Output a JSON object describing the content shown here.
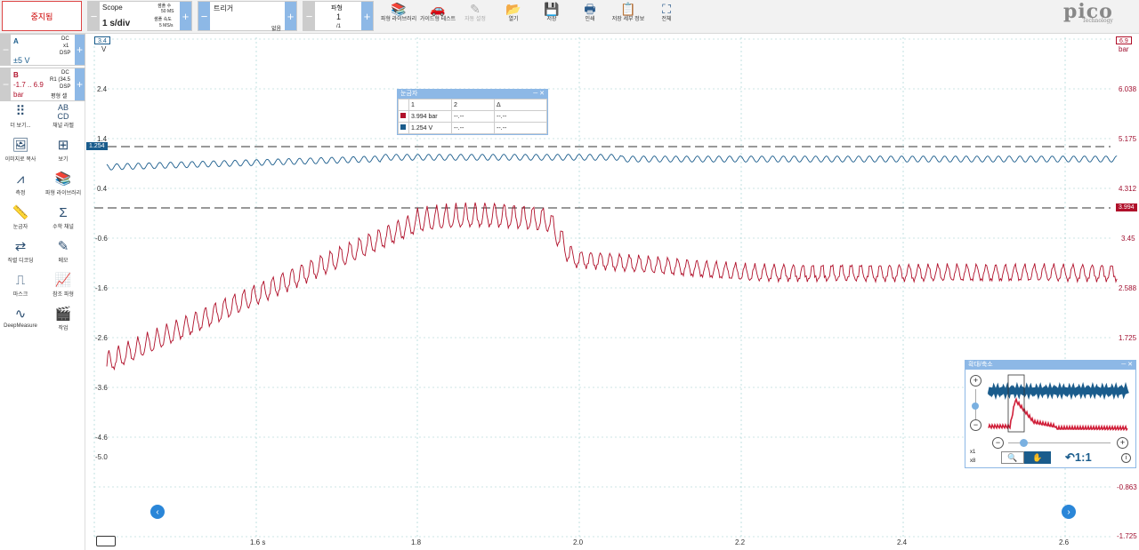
{
  "toolbar": {
    "stop_label": "중지됨",
    "scope_title": "Scope",
    "timebase": "1 s/div",
    "samples_label": "샘플 수",
    "samples": "50 MS",
    "rate_label": "샘플 속도",
    "rate": "5 MS/s",
    "trigger_title": "트리거",
    "trigger_mode": "없음",
    "waveform_title": "파형",
    "waveform_num": "1",
    "waveform_total": "/1",
    "items": [
      {
        "label": "파형 라이브러리",
        "icon": "library-icon",
        "enabled": true
      },
      {
        "label": "가이드형 테스트",
        "icon": "car-icon",
        "enabled": true
      },
      {
        "label": "자동 설정",
        "icon": "wand-icon",
        "enabled": false
      },
      {
        "label": "열기",
        "icon": "folder-icon",
        "enabled": true
      },
      {
        "label": "저장",
        "icon": "save-icon",
        "enabled": true
      },
      {
        "label": "인쇄",
        "icon": "print-icon",
        "enabled": true
      },
      {
        "label": "저장 세부 정보",
        "icon": "details-icon",
        "enabled": true
      },
      {
        "label": "전체",
        "icon": "fullscreen-icon",
        "enabled": true
      }
    ],
    "logo": "pico",
    "logo_sub": "Technology"
  },
  "channels": [
    {
      "name": "A",
      "range": "±5 V",
      "coupling": "DC",
      "probe": "x1",
      "mode": "DSP",
      "color": "#1a5c8c"
    },
    {
      "name": "B",
      "range": "-1.7 .. 6.9",
      "unit": "bar",
      "coupling": "DC",
      "probe": "R1 (34.5",
      "mode": "DSP",
      "extra": "평형 셀",
      "color": "#b0102a"
    }
  ],
  "tools": [
    {
      "label": "더 보기...",
      "icon": "dots-icon"
    },
    {
      "label": "채널 라벨",
      "icon": "abcd-icon"
    },
    {
      "label": "이미지로 복사",
      "icon": "image-icon"
    },
    {
      "label": "보기",
      "icon": "grid-icon"
    },
    {
      "label": "측정",
      "icon": "compass-icon"
    },
    {
      "label": "파형 라이브러리",
      "icon": "library-icon"
    },
    {
      "label": "눈금자",
      "icon": "ruler-icon"
    },
    {
      "label": "수학 채널",
      "icon": "sigma-icon"
    },
    {
      "label": "직렬 디코딩",
      "icon": "serial-icon"
    },
    {
      "label": "메모",
      "icon": "memo-icon"
    },
    {
      "label": "마스크",
      "icon": "mask-icon"
    },
    {
      "label": "참조 파형",
      "icon": "reference-icon"
    },
    {
      "label": "DeepMeasure",
      "icon": "deepmeasure-icon"
    },
    {
      "label": "작업",
      "icon": "clapper-icon"
    }
  ],
  "axes": {
    "left_top": "3.4",
    "left_unit": "V",
    "left_ticks": [
      "2.4",
      "1.4",
      "0.4",
      "-0.6",
      "-1.6",
      "-2.6",
      "-3.6",
      "-4.6",
      "-5.0"
    ],
    "right_top": "6.9",
    "right_unit": "bar",
    "right_ticks": [
      "6.038",
      "5.175",
      "4.312",
      "3.45",
      "2.588",
      "1.725",
      "-0.863",
      "-1.725"
    ],
    "x_ticks": [
      "1.6 s",
      "1.8",
      "2.0",
      "2.2",
      "2.4",
      "2.6"
    ]
  },
  "markers": {
    "a_level": "1.254",
    "b_level": "3.994"
  },
  "ruler": {
    "title": "눈금자",
    "headers": [
      "",
      "1",
      "2",
      "Δ"
    ],
    "rows": [
      {
        "color": "#b0102a",
        "v1": "3.994 bar",
        "v2": "--.--",
        "delta": "--.--"
      },
      {
        "color": "#1a5c8c",
        "v1": "1.254 V",
        "v2": "--.--",
        "delta": "--.--"
      }
    ]
  },
  "zoom_panel": {
    "title": "확대/축소",
    "zoom_x1": "x1",
    "zoom_x8": "x8",
    "one_to_one": "1:1"
  }
}
